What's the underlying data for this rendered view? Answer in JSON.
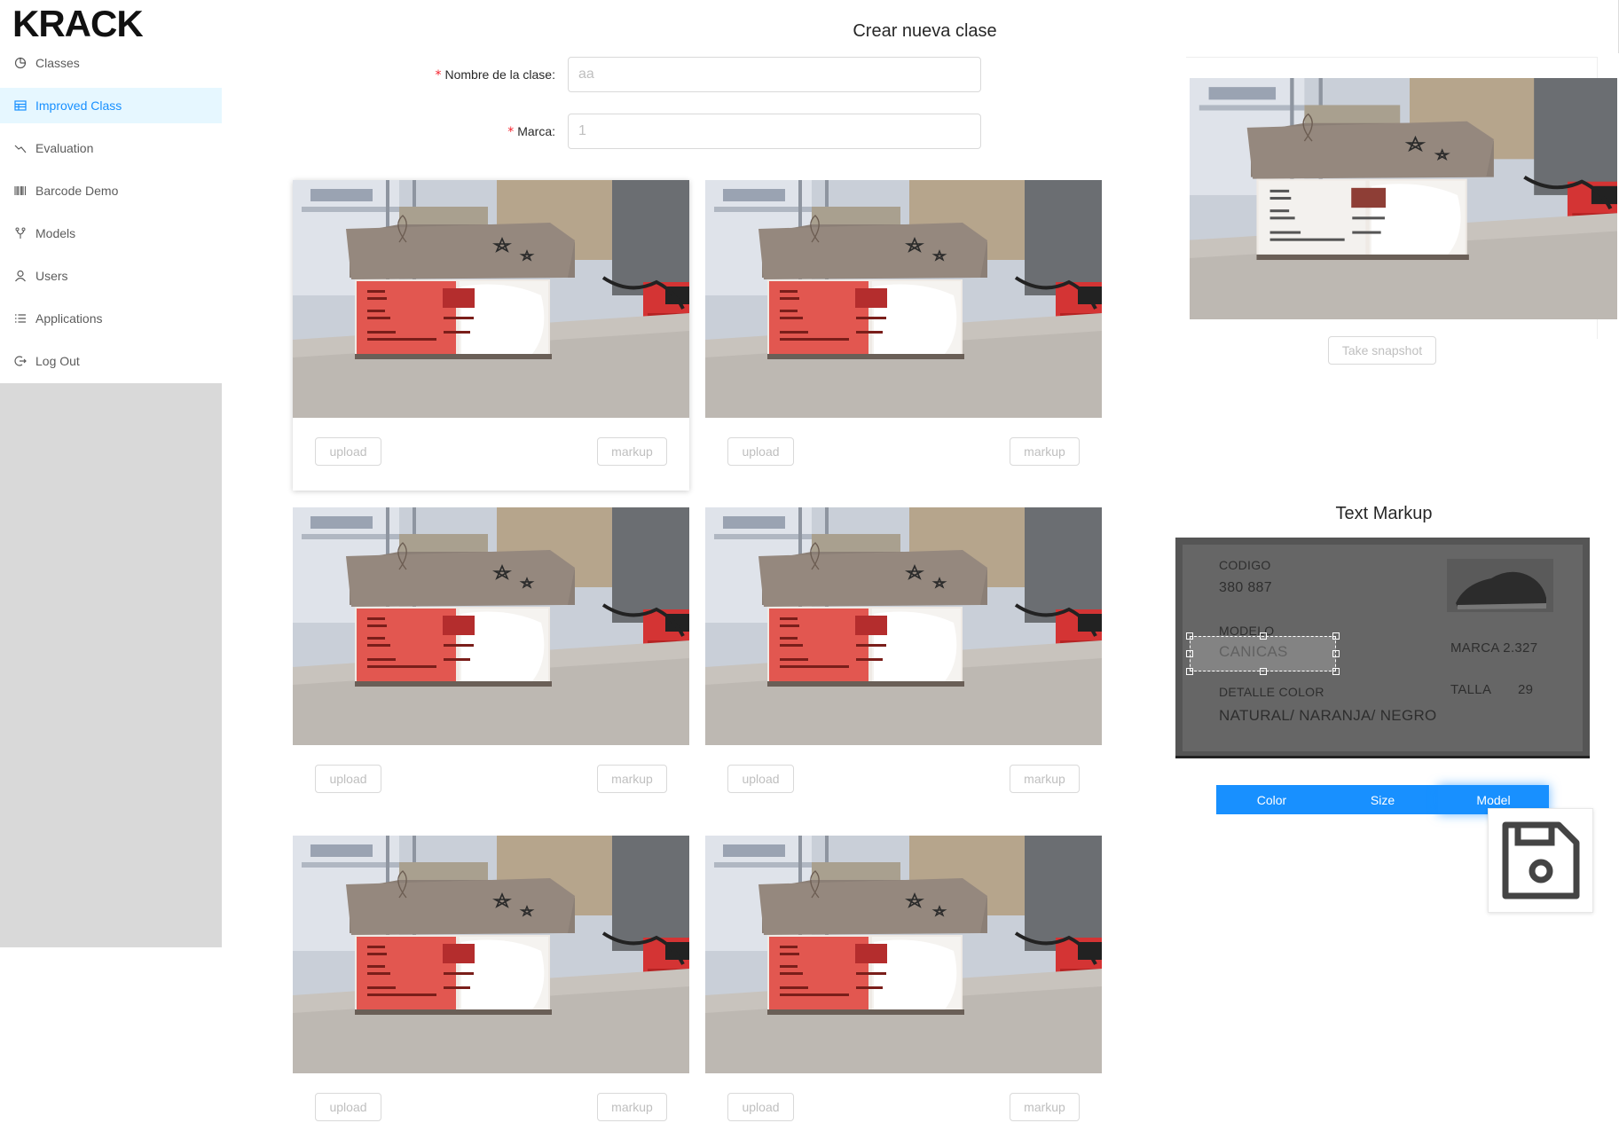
{
  "app": {
    "logo_text": "KRACK"
  },
  "sidebar": {
    "items": [
      {
        "label": "Classes",
        "icon": "pie-chart-icon",
        "active": false
      },
      {
        "label": "Improved Class",
        "icon": "table-icon",
        "active": true
      },
      {
        "label": "Evaluation",
        "icon": "line-chart-icon",
        "active": false
      },
      {
        "label": "Barcode Demo",
        "icon": "barcode-icon",
        "active": false
      },
      {
        "label": "Models",
        "icon": "fork-icon",
        "active": false
      },
      {
        "label": "Users",
        "icon": "user-icon",
        "active": false
      },
      {
        "label": "Applications",
        "icon": "list-icon",
        "active": false
      },
      {
        "label": "Log Out",
        "icon": "logout-icon",
        "active": false
      }
    ]
  },
  "main": {
    "title": "Crear nueva clase",
    "form": {
      "name_label": "Nombre de la clase",
      "name_value": "aa",
      "brand_label": "Marca",
      "brand_value": "1",
      "required_mark": "*"
    },
    "cards": [
      {
        "upload_label": "upload",
        "markup_label": "markup"
      },
      {
        "upload_label": "upload",
        "markup_label": "markup"
      },
      {
        "upload_label": "upload",
        "markup_label": "markup"
      },
      {
        "upload_label": "upload",
        "markup_label": "markup"
      },
      {
        "upload_label": "upload",
        "markup_label": "markup"
      },
      {
        "upload_label": "upload",
        "markup_label": "markup"
      }
    ],
    "label_text": {
      "codigo": "CODIGO",
      "codigo_value": "380 887",
      "modelo": "MODELO",
      "modelo_value": "CANICAS",
      "marca": "MARCA 2.327",
      "talla": "TALLA",
      "talla_value": "29",
      "detalle": "DETALLE COLOR",
      "detalle_value": "NATURAL/ NARANJA/ NEGRO"
    }
  },
  "right_panel": {
    "snapshot_label": "Take snapshot",
    "text_markup_title": "Text Markup",
    "segments": [
      "Color",
      "Size",
      "Model"
    ],
    "active_segment": "Model",
    "save_icon": "save-icon"
  },
  "colors": {
    "accent": "#1890ff",
    "active_bg": "#e6f7ff",
    "required": "#f5222d",
    "label_highlight": "#e8504a"
  }
}
